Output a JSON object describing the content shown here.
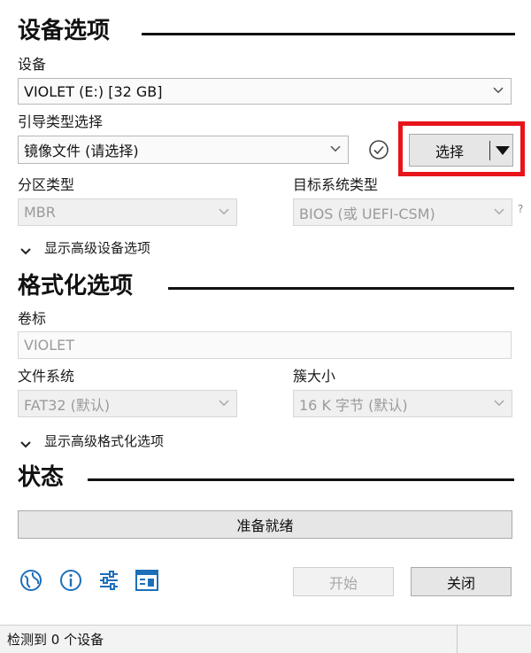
{
  "device_options": {
    "title": "设备选项",
    "device_label": "设备",
    "device_value": "VIOLET (E:) [32 GB]",
    "boot_label": "引导类型选择",
    "boot_value": "镜像文件 (请选择)",
    "select_button": "选择",
    "partition_label": "分区类型",
    "partition_value": "MBR",
    "target_label": "目标系统类型",
    "target_value": "BIOS (或 UEFI-CSM)",
    "help_mark": "?",
    "advanced_toggle": "显示高级设备选项"
  },
  "format_options": {
    "title": "格式化选项",
    "volume_label": "卷标",
    "volume_value": "VIOLET",
    "filesystem_label": "文件系统",
    "filesystem_value": "FAT32 (默认)",
    "cluster_label": "簇大小",
    "cluster_value": "16 K 字节 (默认)",
    "advanced_toggle": "显示高级格式化选项"
  },
  "status": {
    "title": "状态",
    "progress_text": "准备就绪"
  },
  "toolbar": {
    "icons": [
      "globe-icon",
      "info-icon",
      "settings-sliders-icon",
      "log-icon"
    ],
    "start_button": "开始",
    "close_button": "关闭"
  },
  "status_bar": {
    "text": "检测到 0 个设备"
  },
  "colors": {
    "accent_blue": "#1e6fb8",
    "highlight_red": "#e8141b"
  }
}
